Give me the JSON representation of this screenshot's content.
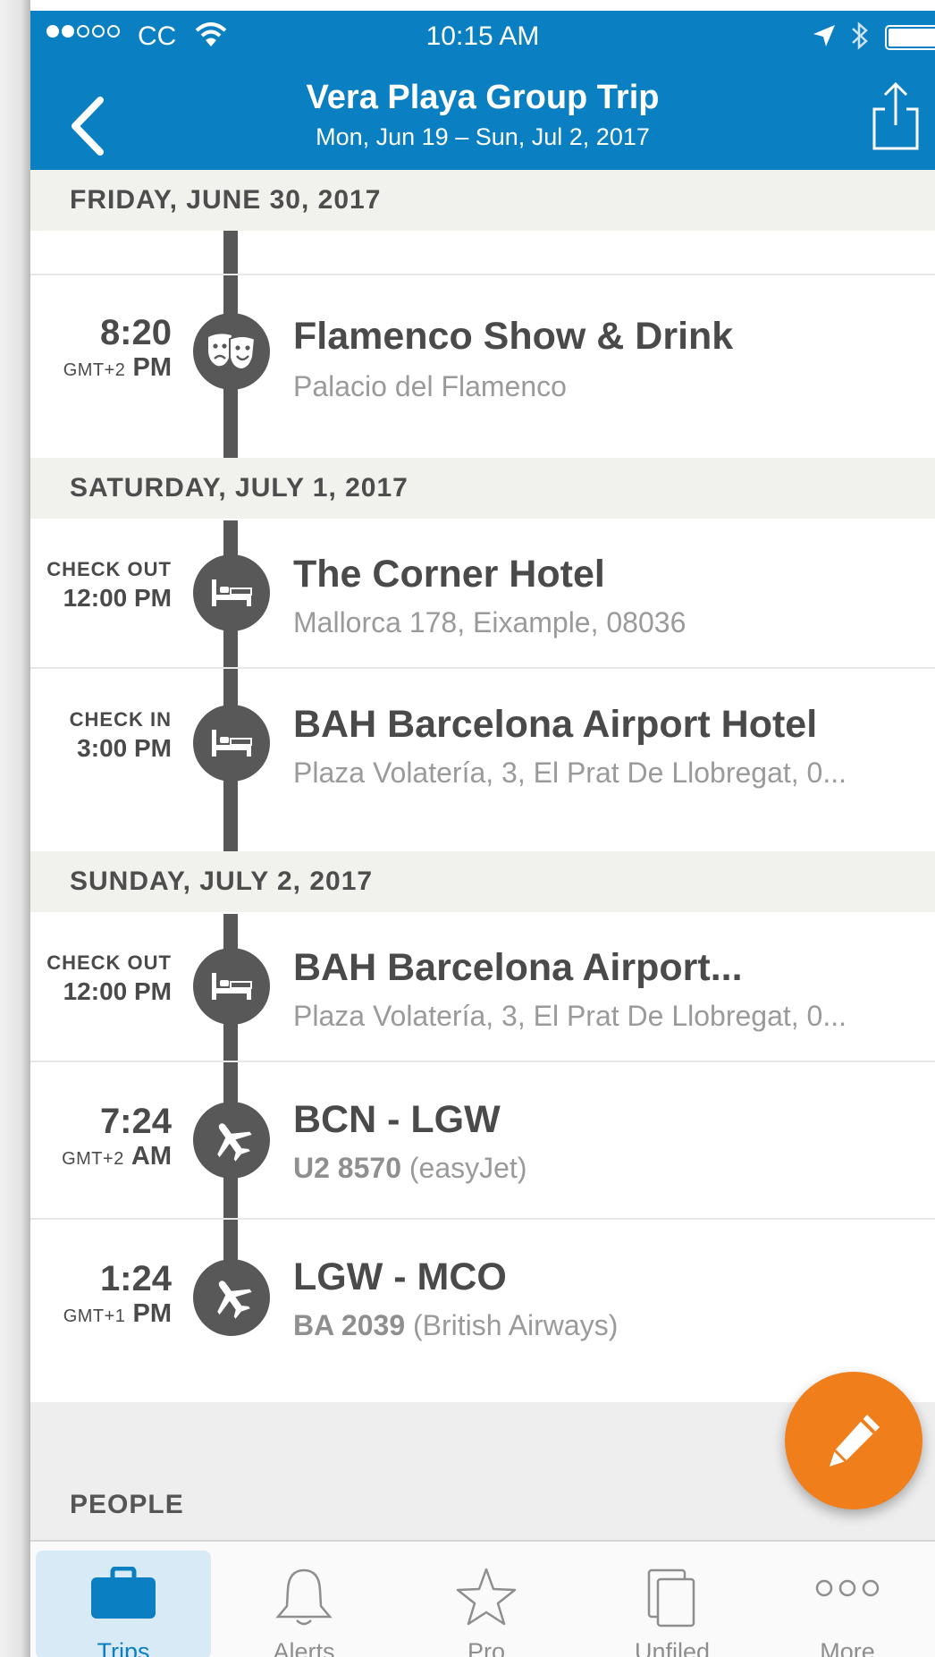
{
  "status_bar": {
    "carrier": "CC",
    "time": "10:15 AM"
  },
  "header": {
    "title": "Vera Playa Group Trip",
    "subtitle": "Mon, Jun 19 – Sun, Jul 2, 2017"
  },
  "sections": [
    {
      "date": "FRIDAY, JUNE 30, 2017",
      "items": [
        {
          "time": "8:20",
          "tz": "GMT+2",
          "ampm": "PM",
          "title": "Flamenco Show & Drink",
          "sub": "Palacio del Flamenco",
          "icon": "theater-masks-icon"
        }
      ]
    },
    {
      "date": "SATURDAY, JULY 1, 2017",
      "items": [
        {
          "label": "CHECK OUT",
          "time": "12:00 PM",
          "title": "The Corner Hotel",
          "sub": "Mallorca 178, Eixample, 08036",
          "icon": "bed-icon"
        },
        {
          "label": "CHECK IN",
          "time": "3:00 PM",
          "title": "BAH Barcelona Airport Hotel",
          "sub": "Plaza Volatería, 3, El Prat De Llobregat, 0...",
          "icon": "bed-icon"
        }
      ]
    },
    {
      "date": "SUNDAY, JULY 2, 2017",
      "items": [
        {
          "label": "CHECK OUT",
          "time": "12:00 PM",
          "title": "BAH Barcelona Airport...",
          "sub": "Plaza Volatería, 3, El Prat De Llobregat, 0...",
          "icon": "bed-icon"
        },
        {
          "time": "7:24",
          "tz": "GMT+2",
          "ampm": "AM",
          "title": "BCN - LGW",
          "flight": "U2 8570",
          "airline": "(easyJet)",
          "icon": "airplane-icon"
        },
        {
          "time": "1:24",
          "tz": "GMT+1",
          "ampm": "PM",
          "title": "LGW - MCO",
          "flight": "BA 2039",
          "airline": "(British Airways)",
          "icon": "airplane-icon"
        }
      ]
    }
  ],
  "people": {
    "label": "PEOPLE"
  },
  "tabs": [
    {
      "label": "Trips",
      "icon": "briefcase-icon",
      "active": true
    },
    {
      "label": "Alerts",
      "icon": "bell-icon"
    },
    {
      "label": "Pro",
      "icon": "star-icon"
    },
    {
      "label": "Unfiled",
      "icon": "documents-icon"
    },
    {
      "label": "More",
      "icon": "more-dots-icon"
    }
  ],
  "colors": {
    "header_blue": "#0a7fc2",
    "fab_orange": "#f07e1b",
    "timeline_gray": "#585858"
  }
}
